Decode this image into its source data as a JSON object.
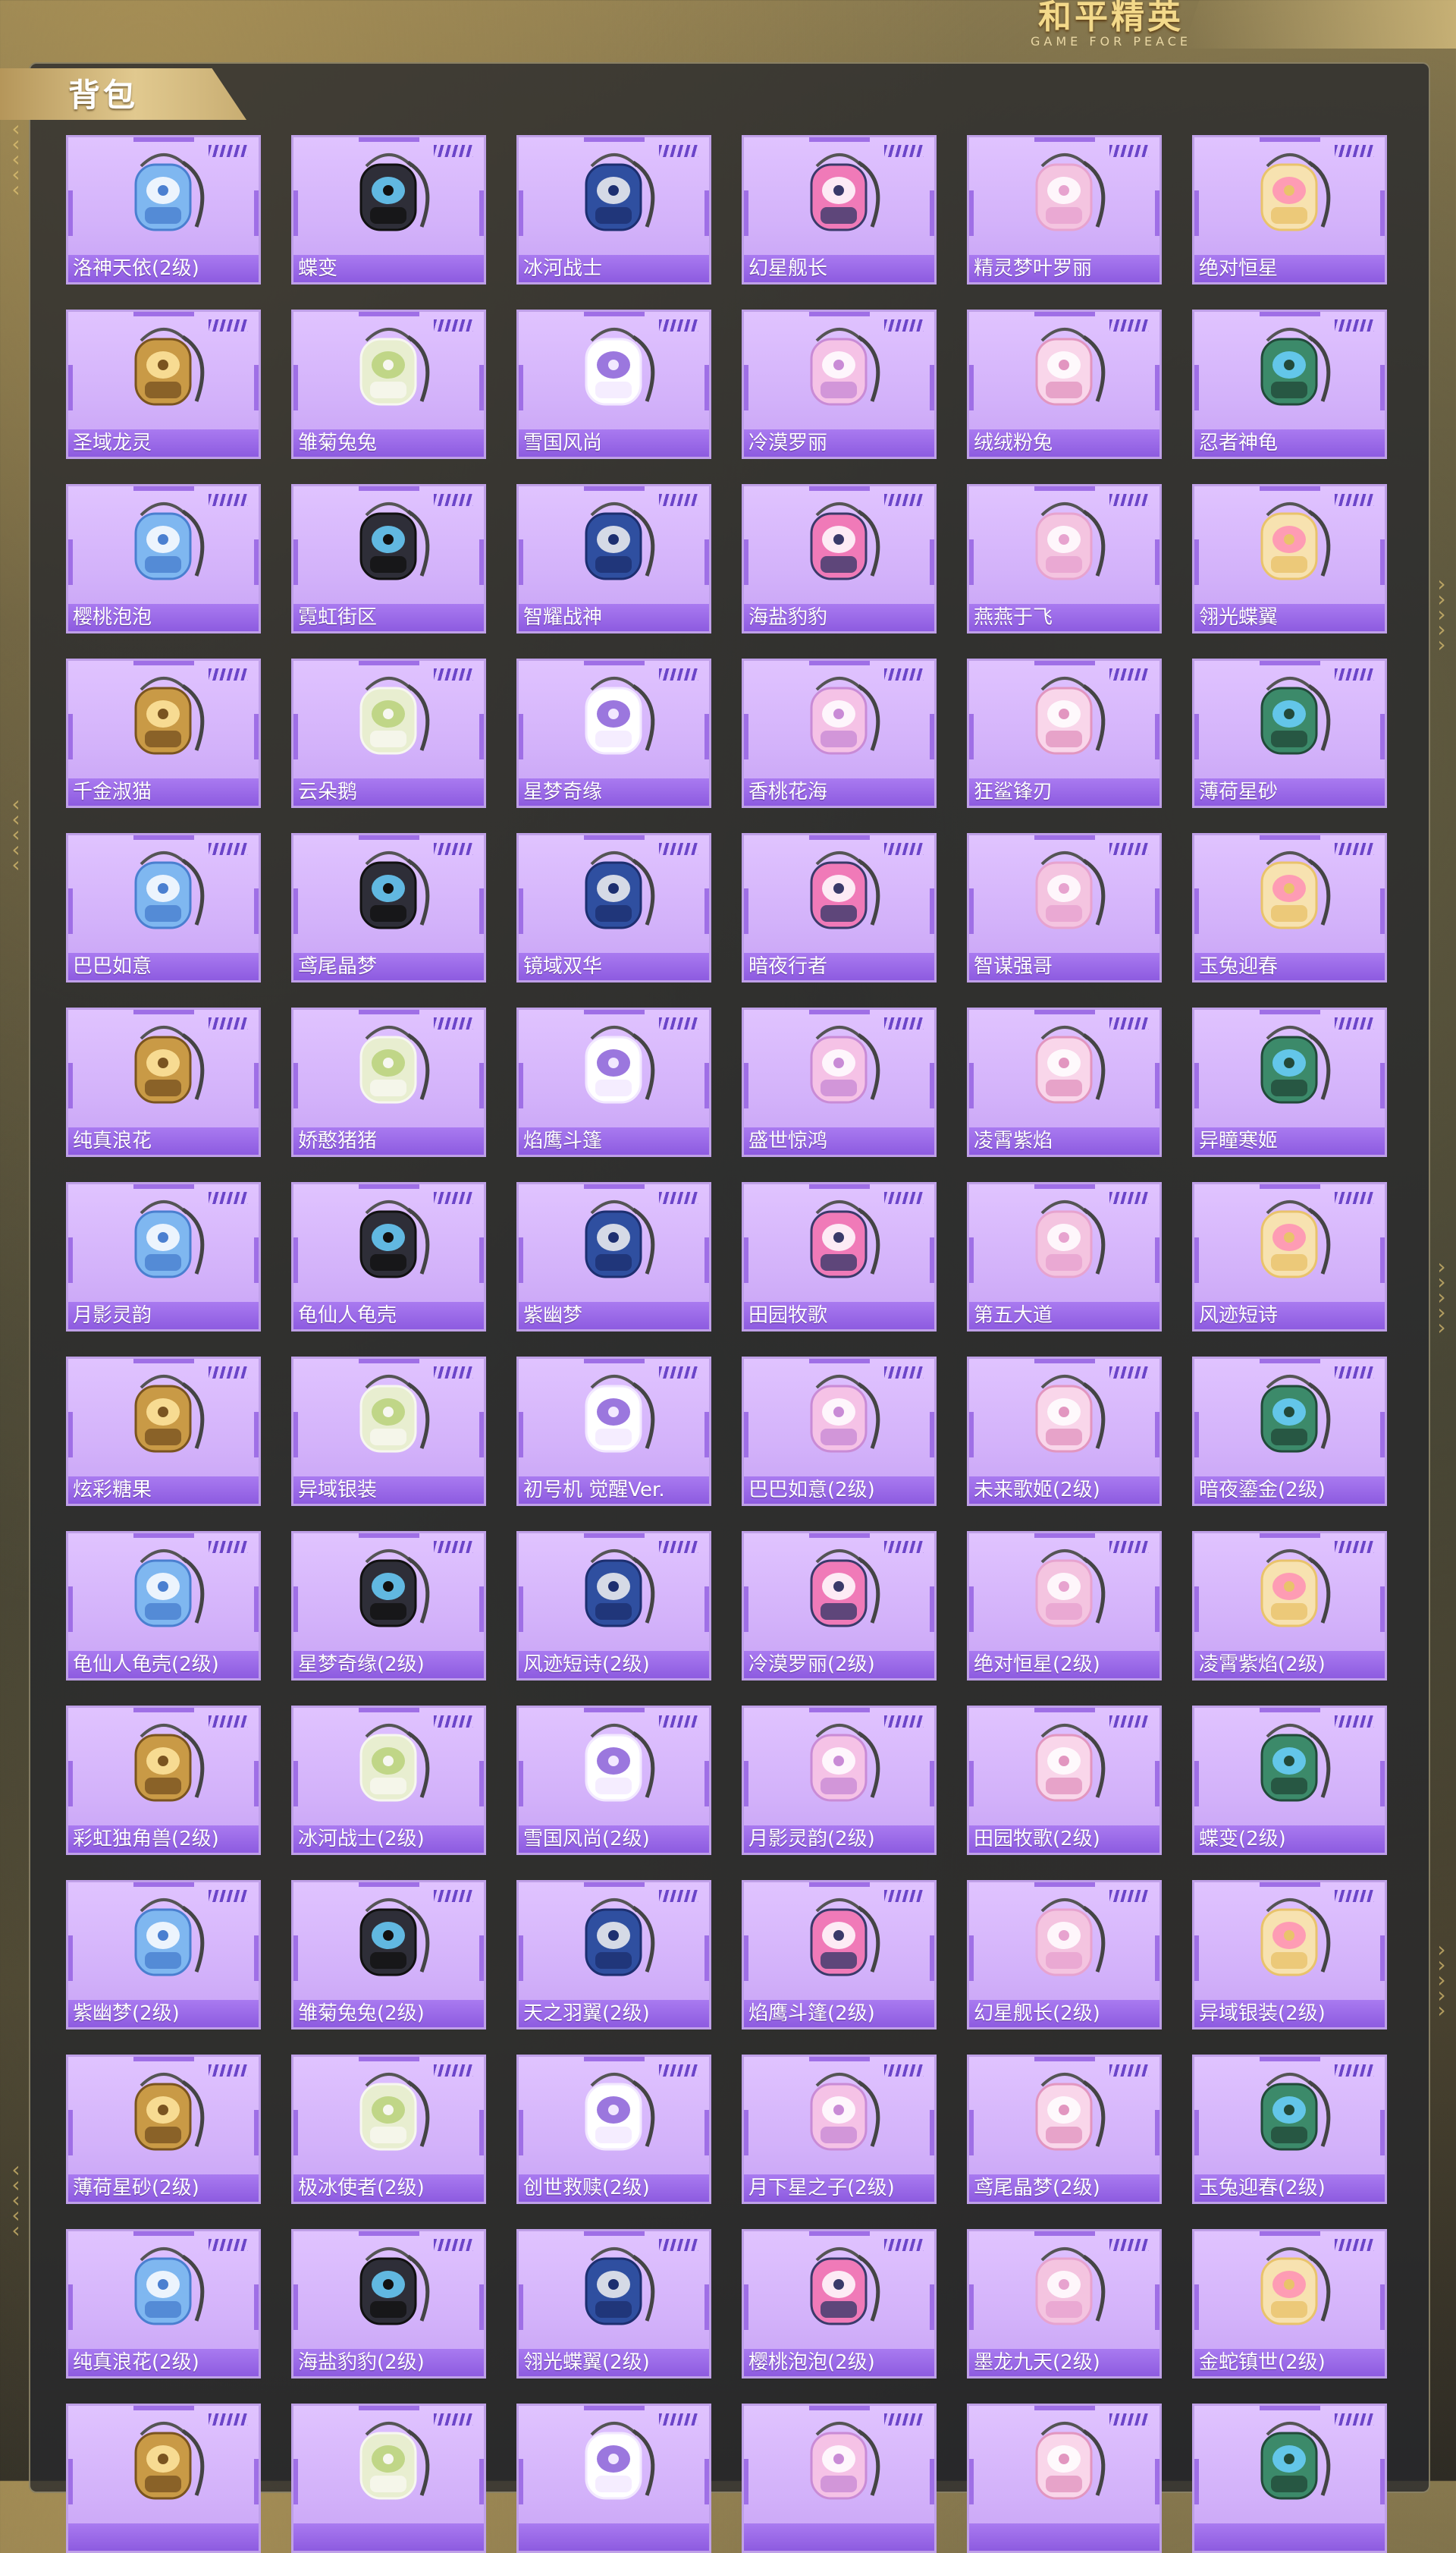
{
  "header": {
    "logo_zh": "和平精英",
    "logo_en": "GAME FOR PEACE"
  },
  "panel": {
    "title": "背包"
  },
  "colors": {
    "card_bg": "#d9b8fd",
    "card_label_bg": "#9a68e8",
    "accent_gold": "#e1c98f"
  },
  "items": [
    {
      "name": "洛神天依(2级)",
      "icon": "backpack-icon"
    },
    {
      "name": "蝶变",
      "icon": "backpack-icon"
    },
    {
      "name": "冰河战士",
      "icon": "backpack-icon"
    },
    {
      "name": "幻星舰长",
      "icon": "backpack-icon"
    },
    {
      "name": "精灵梦叶罗丽",
      "icon": "backpack-icon"
    },
    {
      "name": "绝对恒星",
      "icon": "backpack-icon"
    },
    {
      "name": "圣域龙灵",
      "icon": "backpack-icon"
    },
    {
      "name": "雏菊兔兔",
      "icon": "backpack-icon"
    },
    {
      "name": "雪国风尚",
      "icon": "backpack-icon"
    },
    {
      "name": "冷漠罗丽",
      "icon": "backpack-icon"
    },
    {
      "name": "绒绒粉兔",
      "icon": "backpack-icon"
    },
    {
      "name": "忍者神龟",
      "icon": "backpack-icon"
    },
    {
      "name": "樱桃泡泡",
      "icon": "backpack-icon"
    },
    {
      "name": "霓虹街区",
      "icon": "backpack-icon"
    },
    {
      "name": "智耀战神",
      "icon": "backpack-icon"
    },
    {
      "name": "海盐豹豹",
      "icon": "backpack-icon"
    },
    {
      "name": "燕燕于飞",
      "icon": "backpack-icon"
    },
    {
      "name": "翎光蝶翼",
      "icon": "backpack-icon"
    },
    {
      "name": "千金淑猫",
      "icon": "backpack-icon"
    },
    {
      "name": "云朵鹅",
      "icon": "backpack-icon"
    },
    {
      "name": "星梦奇缘",
      "icon": "backpack-icon"
    },
    {
      "name": "香桃花海",
      "icon": "backpack-icon"
    },
    {
      "name": "狂鲨锋刃",
      "icon": "backpack-icon"
    },
    {
      "name": "薄荷星砂",
      "icon": "backpack-icon"
    },
    {
      "name": "巴巴如意",
      "icon": "backpack-icon"
    },
    {
      "name": "鸢尾晶梦",
      "icon": "backpack-icon"
    },
    {
      "name": "镜域双华",
      "icon": "backpack-icon"
    },
    {
      "name": "暗夜行者",
      "icon": "backpack-icon"
    },
    {
      "name": "智谋强哥",
      "icon": "backpack-icon"
    },
    {
      "name": "玉兔迎春",
      "icon": "backpack-icon"
    },
    {
      "name": "纯真浪花",
      "icon": "backpack-icon"
    },
    {
      "name": "娇憨猪猪",
      "icon": "backpack-icon"
    },
    {
      "name": "焰鹰斗篷",
      "icon": "backpack-icon"
    },
    {
      "name": "盛世惊鸿",
      "icon": "backpack-icon"
    },
    {
      "name": "凌霄紫焰",
      "icon": "backpack-icon"
    },
    {
      "name": "异瞳寒姬",
      "icon": "backpack-icon"
    },
    {
      "name": "月影灵韵",
      "icon": "backpack-icon"
    },
    {
      "name": "龟仙人龟壳",
      "icon": "backpack-icon"
    },
    {
      "name": "紫幽梦",
      "icon": "backpack-icon"
    },
    {
      "name": "田园牧歌",
      "icon": "backpack-icon"
    },
    {
      "name": "第五大道",
      "icon": "backpack-icon"
    },
    {
      "name": "风迹短诗",
      "icon": "backpack-icon"
    },
    {
      "name": "炫彩糖果",
      "icon": "backpack-icon"
    },
    {
      "name": "异域银装",
      "icon": "backpack-icon"
    },
    {
      "name": "初号机 觉醒Ver.",
      "icon": "backpack-icon"
    },
    {
      "name": "巴巴如意(2级)",
      "icon": "backpack-icon"
    },
    {
      "name": "未来歌姬(2级)",
      "icon": "backpack-icon"
    },
    {
      "name": "暗夜鎏金(2级)",
      "icon": "backpack-icon"
    },
    {
      "name": "龟仙人龟壳(2级)",
      "icon": "backpack-icon"
    },
    {
      "name": "星梦奇缘(2级)",
      "icon": "backpack-icon"
    },
    {
      "name": "风迹短诗(2级)",
      "icon": "backpack-icon"
    },
    {
      "name": "冷漠罗丽(2级)",
      "icon": "backpack-icon"
    },
    {
      "name": "绝对恒星(2级)",
      "icon": "backpack-icon"
    },
    {
      "name": "凌霄紫焰(2级)",
      "icon": "backpack-icon"
    },
    {
      "name": "彩虹独角兽(2级)",
      "icon": "backpack-icon"
    },
    {
      "name": "冰河战士(2级)",
      "icon": "backpack-icon"
    },
    {
      "name": "雪国风尚(2级)",
      "icon": "backpack-icon"
    },
    {
      "name": "月影灵韵(2级)",
      "icon": "backpack-icon"
    },
    {
      "name": "田园牧歌(2级)",
      "icon": "backpack-icon"
    },
    {
      "name": "蝶变(2级)",
      "icon": "backpack-icon"
    },
    {
      "name": "紫幽梦(2级)",
      "icon": "backpack-icon"
    },
    {
      "name": "雏菊兔兔(2级)",
      "icon": "backpack-icon"
    },
    {
      "name": "天之羽翼(2级)",
      "icon": "backpack-icon"
    },
    {
      "name": "焰鹰斗篷(2级)",
      "icon": "backpack-icon"
    },
    {
      "name": "幻星舰长(2级)",
      "icon": "backpack-icon"
    },
    {
      "name": "异域银装(2级)",
      "icon": "backpack-icon"
    },
    {
      "name": "薄荷星砂(2级)",
      "icon": "backpack-icon"
    },
    {
      "name": "极冰使者(2级)",
      "icon": "backpack-icon"
    },
    {
      "name": "创世救赎(2级)",
      "icon": "backpack-icon"
    },
    {
      "name": "月下星之子(2级)",
      "icon": "backpack-icon"
    },
    {
      "name": "鸢尾晶梦(2级)",
      "icon": "backpack-icon"
    },
    {
      "name": "玉兔迎春(2级)",
      "icon": "backpack-icon"
    },
    {
      "name": "纯真浪花(2级)",
      "icon": "backpack-icon"
    },
    {
      "name": "海盐豹豹(2级)",
      "icon": "backpack-icon"
    },
    {
      "name": "翎光蝶翼(2级)",
      "icon": "backpack-icon"
    },
    {
      "name": "樱桃泡泡(2级)",
      "icon": "backpack-icon"
    },
    {
      "name": "墨龙九天(2级)",
      "icon": "backpack-icon"
    },
    {
      "name": "金蛇镇世(2级)",
      "icon": "backpack-icon"
    },
    {
      "name": "",
      "icon": "backpack-icon"
    },
    {
      "name": "",
      "icon": "backpack-icon"
    },
    {
      "name": "",
      "icon": "backpack-icon"
    },
    {
      "name": "",
      "icon": "backpack-icon"
    },
    {
      "name": "",
      "icon": "backpack-icon"
    },
    {
      "name": "",
      "icon": "backpack-icon"
    }
  ]
}
